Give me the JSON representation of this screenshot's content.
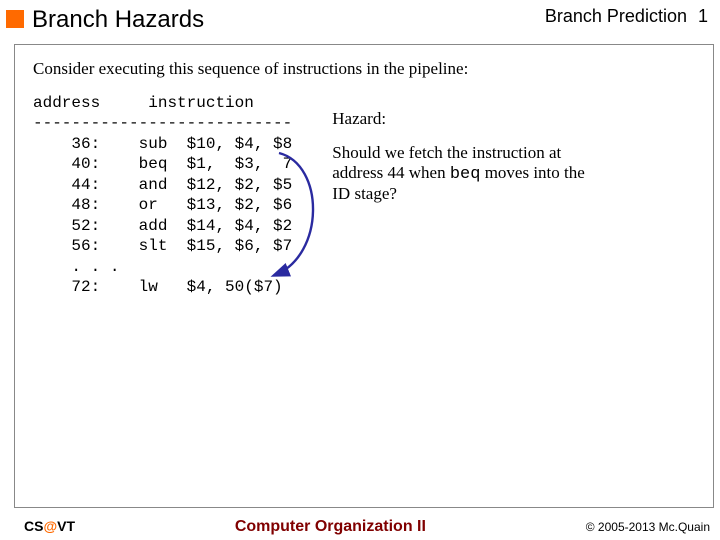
{
  "header": {
    "title": "Branch Hazards",
    "section": "Branch Prediction",
    "page_number": "1"
  },
  "intro": "Consider executing this sequence of instructions in the pipeline:",
  "code": {
    "col_address": "address",
    "col_instruction": "instruction",
    "divider": "---------------------------",
    "rows": [
      {
        "addr": "36:",
        "op": "sub",
        "args": "$10, $4, $8"
      },
      {
        "addr": "40:",
        "op": "beq",
        "args": "$1,  $3,  7"
      },
      {
        "addr": "44:",
        "op": "and",
        "args": "$12, $2, $5"
      },
      {
        "addr": "48:",
        "op": "or ",
        "args": "$13, $2, $6"
      },
      {
        "addr": "52:",
        "op": "add",
        "args": "$14, $4, $2"
      },
      {
        "addr": "56:",
        "op": "slt",
        "args": "$15, $6, $7"
      },
      {
        "addr": ". . .",
        "op": "",
        "args": ""
      },
      {
        "addr": "72:",
        "op": "lw ",
        "args": "$4, 50($7)"
      }
    ]
  },
  "side": {
    "hazard_label": "Hazard:",
    "question_pre": "Should we fetch the instruction at address 44 when ",
    "question_mono": "beq",
    "question_post": " moves into the ID stage?"
  },
  "footer": {
    "org_pre": "CS",
    "org_at": "@",
    "org_post": "VT",
    "center": "Computer Organization II",
    "copyright": "© 2005-2013 Mc.Quain"
  },
  "colors": {
    "accent": "#ff6a00",
    "course": "#800000",
    "arrow": "#2a2aa0"
  }
}
